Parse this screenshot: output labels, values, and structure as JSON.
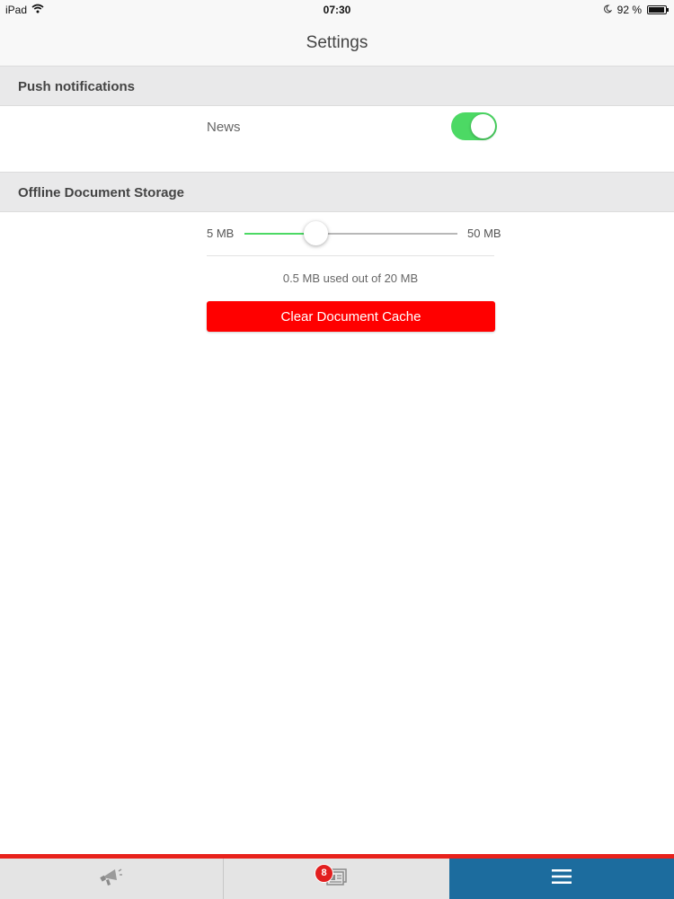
{
  "status_bar": {
    "device": "iPad",
    "time": "07:30",
    "battery": "92 %",
    "battery_level": 0.92
  },
  "nav": {
    "title": "Settings"
  },
  "push_notifications": {
    "header": "Push notifications",
    "news_label": "News",
    "news_enabled": true
  },
  "offline_storage": {
    "header": "Offline Document Storage",
    "min_label": "5 MB",
    "max_label": "50 MB",
    "slider_min": 5,
    "slider_max": 50,
    "slider_value": 20,
    "usage_text": "0.5 MB used out of 20 MB",
    "clear_button_label": "Clear Document Cache"
  },
  "tab_bar": {
    "tabs": [
      {
        "icon": "megaphone-icon"
      },
      {
        "icon": "documents-icon",
        "badge": "8"
      },
      {
        "icon": "menu-icon",
        "selected": true
      }
    ]
  },
  "colors": {
    "accent_red": "#ff0000",
    "toggle_green": "#4cd964",
    "tab_selected": "#1c6c9e",
    "tab_bar_accent": "#e8221c"
  }
}
